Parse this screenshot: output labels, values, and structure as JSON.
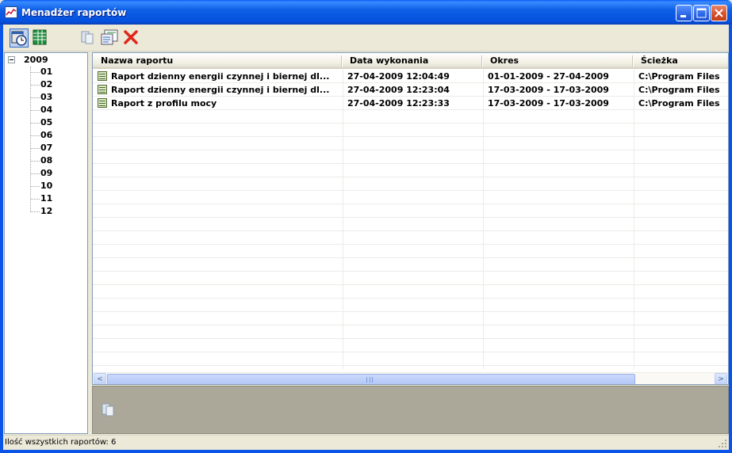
{
  "window": {
    "title": "Menadżer raportów",
    "titlebar_color": "#0A54E8"
  },
  "toolbar": {
    "buttons": [
      {
        "icon": "calendar-clock-icon",
        "pressed": true
      },
      {
        "icon": "table-view-icon",
        "pressed": false
      },
      {
        "icon": "report-preview-icon",
        "pressed": false
      },
      {
        "icon": "report-properties-icon",
        "pressed": false
      },
      {
        "icon": "delete-icon",
        "pressed": false
      }
    ]
  },
  "tree": {
    "root": "2009",
    "expander": "−",
    "items": [
      "01",
      "02",
      "03",
      "04",
      "05",
      "06",
      "07",
      "08",
      "09",
      "10",
      "11",
      "12"
    ]
  },
  "table": {
    "columns": [
      "Nazwa raportu",
      "Data wykonania",
      "Okres",
      "Ścieżka"
    ],
    "rows": [
      {
        "name": "Raport dzienny energii czynnej i biernej dl...",
        "date": "27-04-2009 12:04:49",
        "period": "01-01-2009 - 27-04-2009",
        "path": "C:\\Program Files"
      },
      {
        "name": "Raport dzienny energii czynnej i biernej dl...",
        "date": "27-04-2009 12:23:04",
        "period": "17-03-2009 - 17-03-2009",
        "path": "C:\\Program Files"
      },
      {
        "name": "Raport z profilu mocy",
        "date": "27-04-2009 12:23:33",
        "period": "17-03-2009 - 17-03-2009",
        "path": "C:\\Program Files"
      }
    ]
  },
  "scrollbar": {
    "left_arrow": "<",
    "right_arrow": ">"
  },
  "status": {
    "text": "Ilość wszystkich raportów: 6"
  }
}
